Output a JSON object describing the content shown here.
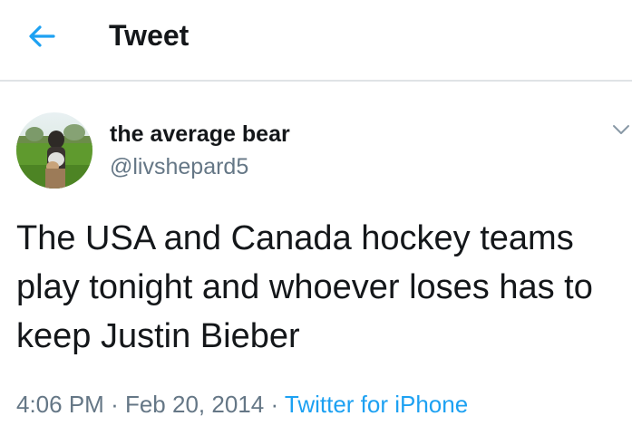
{
  "header": {
    "title": "Tweet",
    "back_icon": "arrow-left-icon"
  },
  "colors": {
    "accent": "#1da1f2",
    "text_primary": "#14171a",
    "text_secondary": "#657786",
    "divider": "#dfe3e6"
  },
  "tweet": {
    "display_name": "the average bear",
    "handle": "@livshepard5",
    "text": "The USA and Canada hockey teams play tonight and whoever loses has to keep Justin Bieber",
    "time": "4:06 PM",
    "separator": "·",
    "date": "Feb 20, 2014",
    "source": "Twitter for iPhone",
    "menu_icon": "chevron-down-icon"
  }
}
